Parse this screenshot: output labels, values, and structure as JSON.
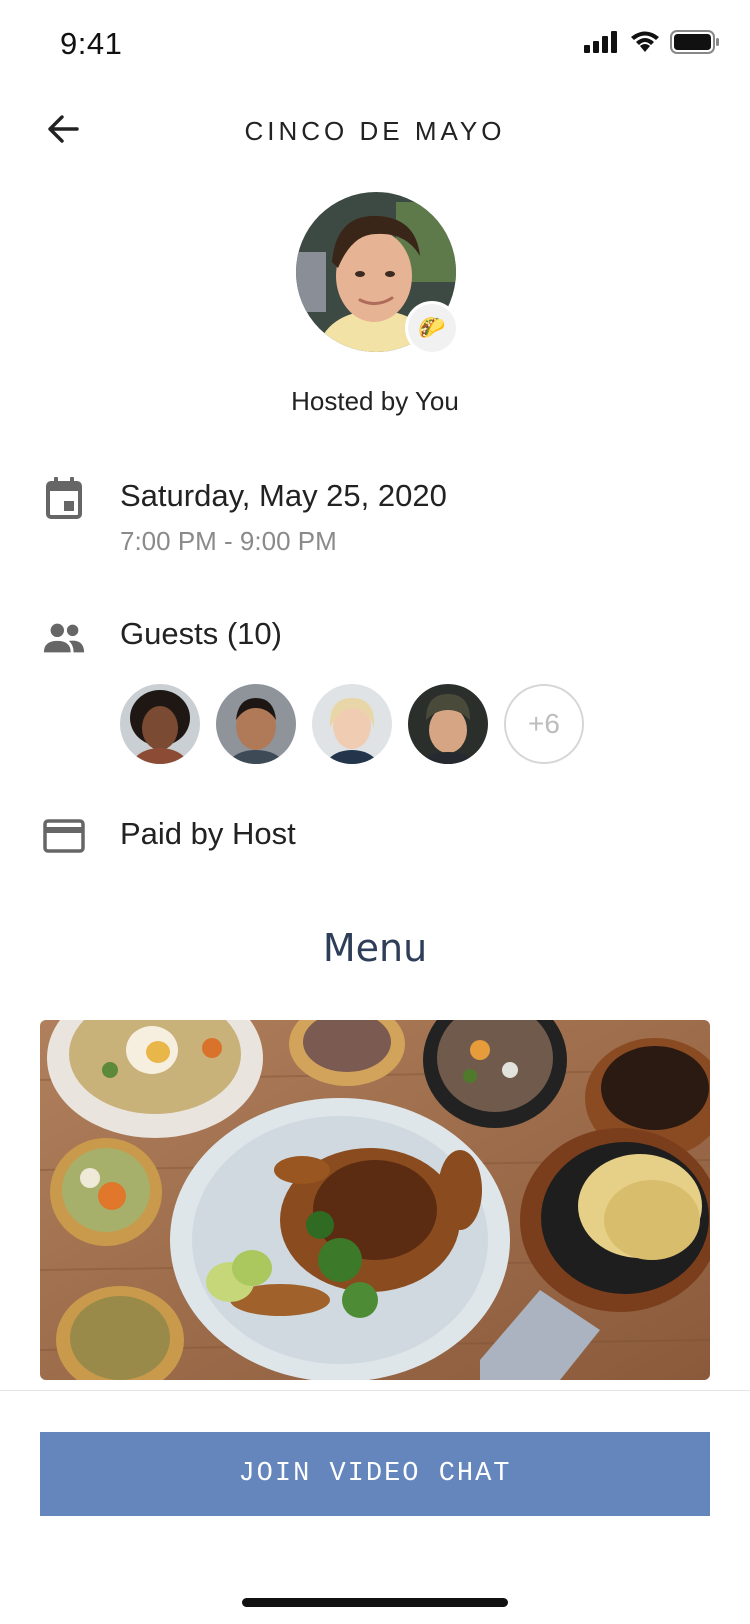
{
  "status_bar": {
    "time": "9:41"
  },
  "header": {
    "title": "CINCO DE MAYO"
  },
  "host": {
    "label": "Hosted by You",
    "badge_emoji": "🌮"
  },
  "event": {
    "date": "Saturday, May 25, 2020",
    "time": "7:00 PM - 9:00 PM"
  },
  "guests": {
    "label": "Guests (10)",
    "more": "+6"
  },
  "payment": {
    "label": "Paid by Host"
  },
  "menu": {
    "title": "Menu"
  },
  "cta": {
    "label": "JOIN VIDEO CHAT"
  },
  "colors": {
    "accent": "#6486bd",
    "menu_title": "#2e3e58",
    "muted": "#8a8a8a",
    "icon_gray": "#666666"
  },
  "icons": [
    "back-arrow-icon",
    "calendar-icon",
    "people-icon",
    "credit-card-icon",
    "signal-icon",
    "wifi-icon",
    "battery-icon"
  ]
}
